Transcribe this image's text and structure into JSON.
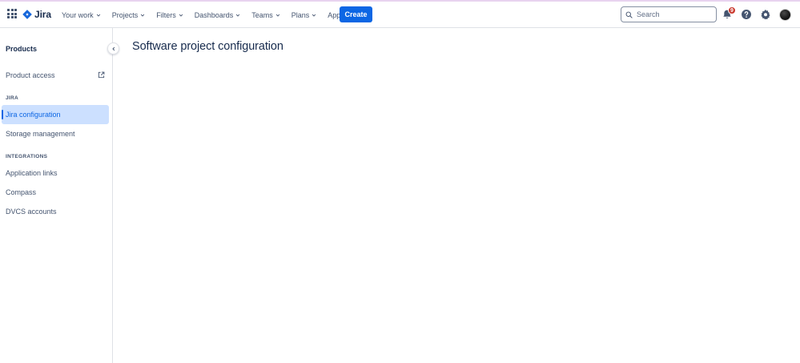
{
  "app": {
    "name": "Jira"
  },
  "colors": {
    "accent": "#0c66e4",
    "badge": "#c9372c",
    "active_bg": "#cce0ff"
  },
  "topnav": {
    "menu": [
      {
        "label": "Your work"
      },
      {
        "label": "Projects"
      },
      {
        "label": "Filters"
      },
      {
        "label": "Dashboards"
      },
      {
        "label": "Teams"
      },
      {
        "label": "Plans"
      },
      {
        "label": "Apps"
      }
    ],
    "create_label": "Create",
    "search": {
      "placeholder": "Search",
      "value": ""
    },
    "notifications_count": "9",
    "icons": [
      "app-switcher-icon",
      "jira-logo-icon",
      "search-icon",
      "notification-icon",
      "help-icon",
      "settings-icon"
    ]
  },
  "sidebar": {
    "title": "Products",
    "product_access": "Product access",
    "sections": [
      {
        "heading": "JIRA",
        "items": [
          {
            "label": "Jira configuration",
            "active": true
          },
          {
            "label": "Storage management"
          }
        ]
      },
      {
        "heading": "INTEGRATIONS",
        "items": [
          {
            "label": "Application links"
          },
          {
            "label": "Compass"
          },
          {
            "label": "DVCS accounts"
          }
        ]
      }
    ]
  },
  "main": {
    "title": "Software project configuration"
  }
}
